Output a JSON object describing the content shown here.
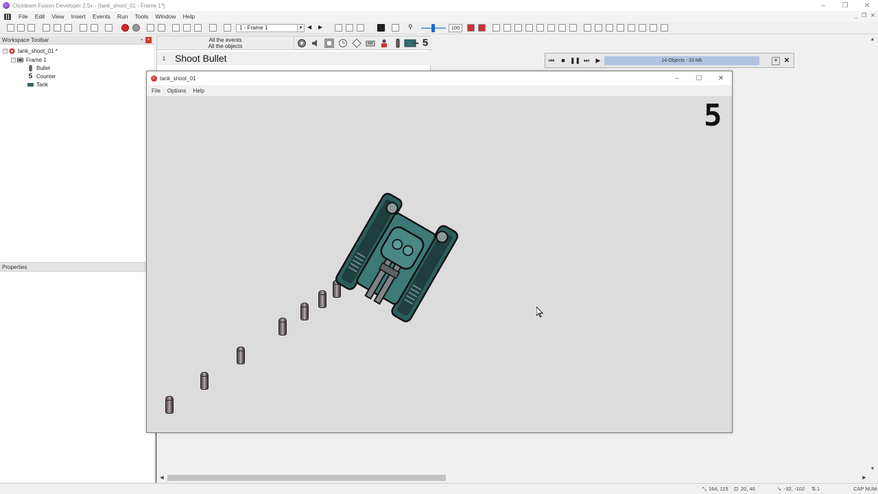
{
  "app": {
    "title": "Clickteam Fusion Developer 2.5+ - [tank_shoot_01 - Frame 1*]",
    "window_controls": [
      "–",
      "❐",
      "✕"
    ]
  },
  "menu": {
    "items": [
      "File",
      "Edit",
      "View",
      "Insert",
      "Events",
      "Run",
      "Tools",
      "Window",
      "Help"
    ]
  },
  "toolbar": {
    "frame_select": "1 - Frame 1",
    "zoom_value": "100"
  },
  "workspace": {
    "header": "Workspace Toolbar",
    "tree": {
      "app": "tank_shoot_01 *",
      "frame": "Frame 1",
      "objects": [
        "Bullet",
        "Counter",
        "Tank"
      ]
    }
  },
  "properties": {
    "header": "Properties"
  },
  "event_editor": {
    "header_line1": "All the events",
    "header_line2": "All the objects",
    "counter_glyph": "5",
    "row_number": "1",
    "row_title": "Shoot Bullet"
  },
  "debugger": {
    "status": "14 Objects - 33 Mb",
    "plus": "+",
    "close": "✕"
  },
  "game_window": {
    "title": "tank_shoot_01",
    "menu": [
      "File",
      "Options",
      "Help"
    ],
    "counter_value": "5"
  },
  "statusbar": {
    "mouse_pos": "164, 115",
    "size": "20, 40",
    "offset": "-32, -102",
    "layer": "1",
    "keys": "CAP NUM"
  },
  "colors": {
    "tank_body": "#2f6f6c",
    "tank_dark": "#1b3b3a",
    "game_bg": "#dcdcdc",
    "debugger_status_bg": "#aec4e0"
  }
}
